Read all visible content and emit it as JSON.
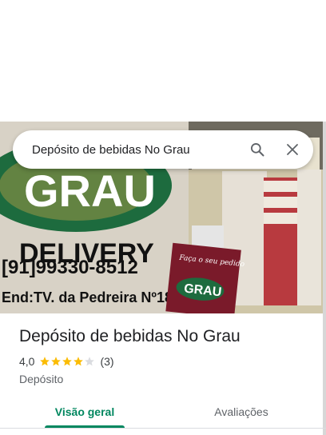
{
  "search": {
    "query": "Depósito de bebidas No Grau"
  },
  "photo": {
    "sign_brand": "GRAU",
    "sign_delivery": "DELIVERY",
    "sign_phone": "[91]99330-8512",
    "sign_address": "End:TV. da Pedreira Nº185",
    "poster_tagline": "Faça o seu pedido",
    "poster_brand": "GRAU"
  },
  "place": {
    "name": "Depósito de bebidas No Grau",
    "rating": "4,0",
    "stars_filled": 4,
    "review_count": "(3)",
    "category": "Depósito"
  },
  "tabs": [
    {
      "label": "Visão geral",
      "active": true
    },
    {
      "label": "Avaliações",
      "active": false
    }
  ],
  "colors": {
    "accent": "#01875f",
    "star": "#fbbc04",
    "star_empty": "#dadce0"
  }
}
